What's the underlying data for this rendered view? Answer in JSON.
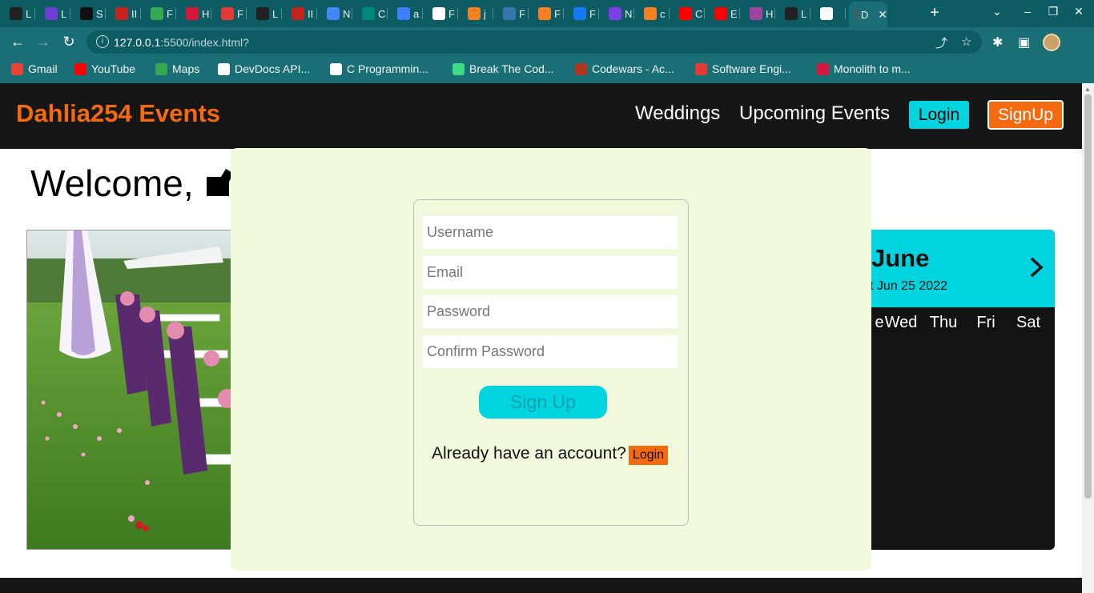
{
  "browser": {
    "tabs": [
      {
        "initial": "L",
        "favicon_color": "#222222"
      },
      {
        "initial": "L",
        "favicon_color": "#6b3fd4"
      },
      {
        "initial": "S",
        "favicon_color": "#111111"
      },
      {
        "initial": "II",
        "favicon_color": "#c5221f"
      },
      {
        "initial": "F",
        "favicon_color": "#34a853"
      },
      {
        "initial": "H",
        "favicon_color": "#d6173c"
      },
      {
        "initial": "F",
        "favicon_color": "#e53935"
      },
      {
        "initial": "L",
        "favicon_color": "#222222"
      },
      {
        "initial": "II",
        "favicon_color": "#c5221f"
      },
      {
        "initial": "N",
        "favicon_color": "#4285f4"
      },
      {
        "initial": "C",
        "favicon_color": "#00897b"
      },
      {
        "initial": "a",
        "favicon_color": "#3d7eff"
      },
      {
        "initial": "F",
        "favicon_color": "#ffffff"
      },
      {
        "initial": "j",
        "favicon_color": "#f48024"
      },
      {
        "initial": "F",
        "favicon_color": "#3776ab"
      },
      {
        "initial": "F",
        "favicon_color": "#f48024"
      },
      {
        "initial": "F",
        "favicon_color": "#1877f2"
      },
      {
        "initial": "N",
        "favicon_color": "#7b3fe4"
      },
      {
        "initial": "c",
        "favicon_color": "#f48024"
      },
      {
        "initial": "C",
        "favicon_color": "#ff0000"
      },
      {
        "initial": "E",
        "favicon_color": "#ff0000"
      },
      {
        "initial": "H",
        "favicon_color": "#a044a0"
      },
      {
        "initial": "L",
        "favicon_color": "#222222"
      },
      {
        "initial": "",
        "favicon_color": "#ffffff"
      },
      {
        "initial": "D",
        "favicon_color": "#555555",
        "active": true
      }
    ],
    "url_host": "127.0.0.1",
    "url_rest": ":5500/index.html?",
    "bookmarks": [
      {
        "label": "Gmail",
        "icon_color": "#ea4335"
      },
      {
        "label": "YouTube",
        "icon_color": "#ff0000"
      },
      {
        "label": "Maps",
        "icon_color": "#34a853"
      },
      {
        "label": "DevDocs API...",
        "icon_color": "#ffffff"
      },
      {
        "label": "C Programmin...",
        "icon_color": "#ffffff"
      },
      {
        "label": "Break The Cod...",
        "icon_color": "#3ddc84"
      },
      {
        "label": "Codewars - Ac...",
        "icon_color": "#b1361e"
      },
      {
        "label": "Software Engi...",
        "icon_color": "#e53935"
      },
      {
        "label": "Monolith to m...",
        "icon_color": "#d6173c"
      }
    ]
  },
  "site": {
    "brand": "Dahlia254 Events",
    "nav": {
      "weddings": "Weddings",
      "upcoming": "Upcoming Events",
      "login": "Login",
      "signup": "SignUp"
    },
    "welcome": "Welcome,",
    "calendar": {
      "month": "June",
      "date_text": "t Jun 25 2022",
      "weekdays": [
        "e",
        "Wed",
        "Thu",
        "Fri",
        "Sat"
      ]
    }
  },
  "modal": {
    "username_placeholder": "Username",
    "email_placeholder": "Email",
    "password_placeholder": "Password",
    "confirm_placeholder": "Confirm Password",
    "signup_button": "Sign Up",
    "have_account": "Already have an account?",
    "login_button": "Login"
  },
  "colors": {
    "accent_orange": "#f36a10",
    "accent_cyan": "#00d5df",
    "chrome_teal": "#1a6e75",
    "modal_bg": "#f2f8dc"
  }
}
